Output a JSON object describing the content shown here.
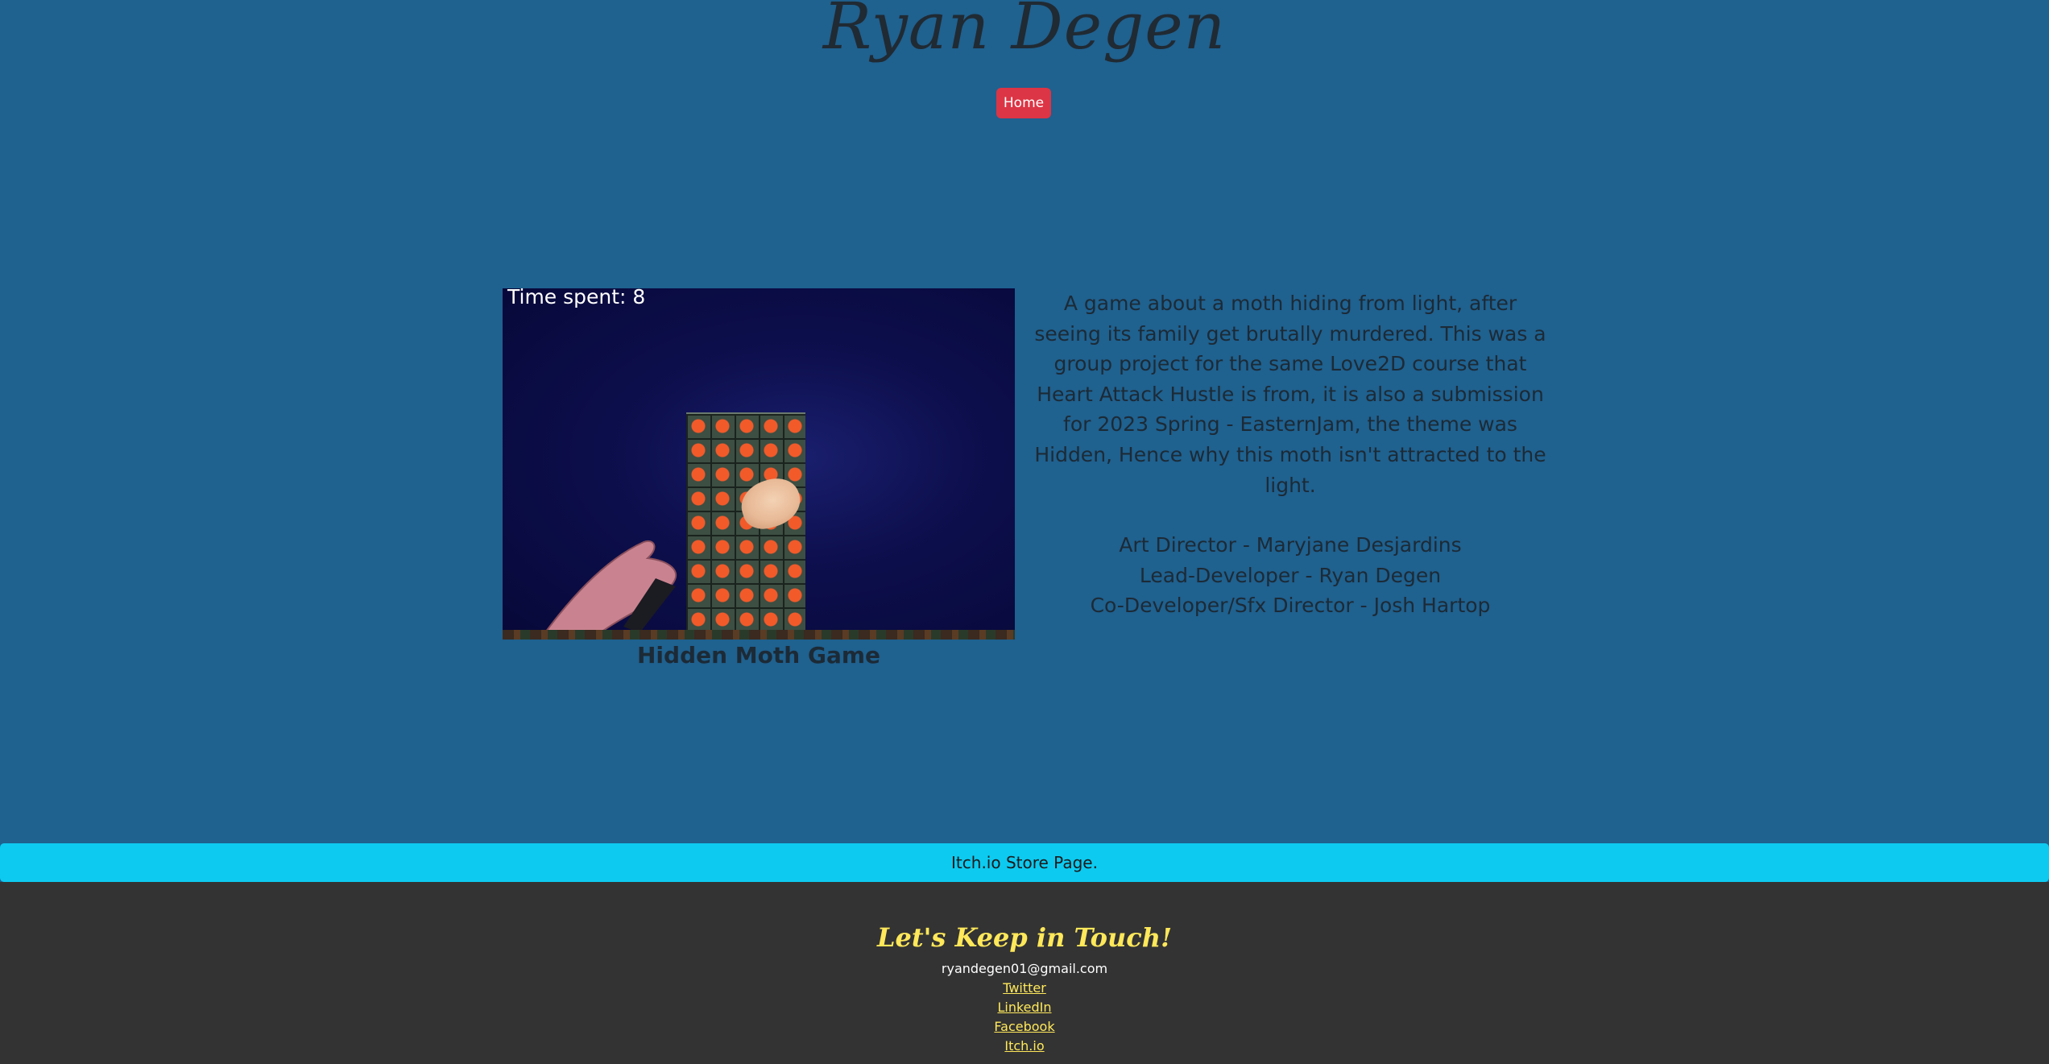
{
  "header": {
    "title": "Ryan Degen",
    "nav_home": "Home"
  },
  "project": {
    "game_hud": "Time spent: 8",
    "caption": "Hidden Moth Game",
    "description": "A game about a moth hiding from light, after seeing its family get brutally murdered. This was a group project for the same Love2D course that Heart Attack Hustle is from, it is also a submission for 2023 Spring - EasternJam, the theme was Hidden, Hence why this moth isn't attracted to the light.",
    "credits": [
      "Art Director - Maryjane Desjardins",
      "Lead-Developer - Ryan Degen",
      "Co-Developer/Sfx Director - Josh Hartop"
    ],
    "store_button": "Itch.io Store Page."
  },
  "footer": {
    "heading": "Let's Keep in Touch!",
    "email": "ryandegen01@gmail.com",
    "links": [
      "Twitter",
      "LinkedIn",
      "Facebook",
      "Itch.io"
    ]
  },
  "colors": {
    "page_background": "#1f618f",
    "nav_button": "#dc3545",
    "store_bar": "#0dcaf0",
    "footer_background": "#333333",
    "footer_accent": "#ffe85a"
  }
}
